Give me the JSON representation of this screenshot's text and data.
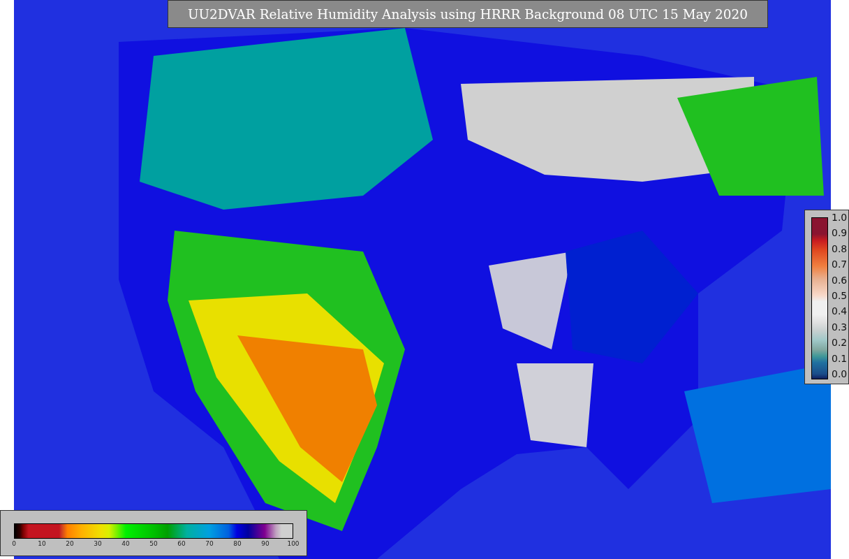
{
  "title": "UU2DVAR Relative Humidity Analysis using HRRR Background 08 UTC 15 May 2020",
  "humidity_colorbar": {
    "ticks": [
      "0",
      "10",
      "20",
      "30",
      "40",
      "50",
      "60",
      "70",
      "80",
      "90",
      "100"
    ]
  },
  "observation_colorbar": {
    "ticks": [
      "1.0",
      "0.9",
      "0.8",
      "0.7",
      "0.6",
      "0.5",
      "0.4",
      "0.3",
      "0.2",
      "0.1",
      "0.0"
    ]
  }
}
